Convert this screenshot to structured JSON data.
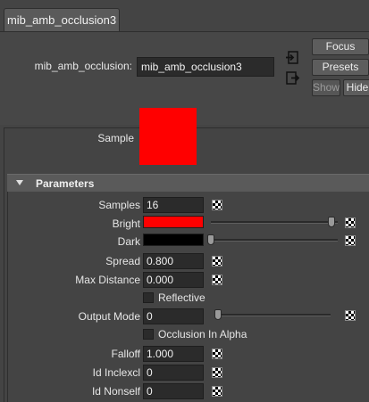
{
  "tab": {
    "label": "mib_amb_occlusion3"
  },
  "node": {
    "type_label": "mib_amb_occlusion:",
    "name_value": "mib_amb_occlusion3"
  },
  "buttons": {
    "focus": "Focus",
    "presets": "Presets",
    "show": "Show",
    "hide": "Hide"
  },
  "sample": {
    "label": "Sample",
    "color": "#ff0000"
  },
  "section": {
    "title": "Parameters"
  },
  "params": {
    "samples": {
      "label": "Samples",
      "value": "16"
    },
    "bright": {
      "label": "Bright",
      "color": "#ff0000",
      "slider_level": 0.98
    },
    "dark": {
      "label": "Dark",
      "color": "#000000",
      "slider_level": 0.0
    },
    "spread": {
      "label": "Spread",
      "value": "0.800"
    },
    "max_distance": {
      "label": "Max Distance",
      "value": "0.000"
    },
    "reflective": {
      "label": "Reflective",
      "checked": false
    },
    "output_mode": {
      "label": "Output Mode",
      "value": "0",
      "slider_level": 0.0
    },
    "occlusion_in_alpha": {
      "label": "Occlusion In Alpha",
      "checked": false
    },
    "falloff": {
      "label": "Falloff",
      "value": "1.000"
    },
    "id_inclexcl": {
      "label": "Id Inclexcl",
      "value": "0"
    },
    "id_nonself": {
      "label": "Id Nonself",
      "value": "0"
    }
  }
}
